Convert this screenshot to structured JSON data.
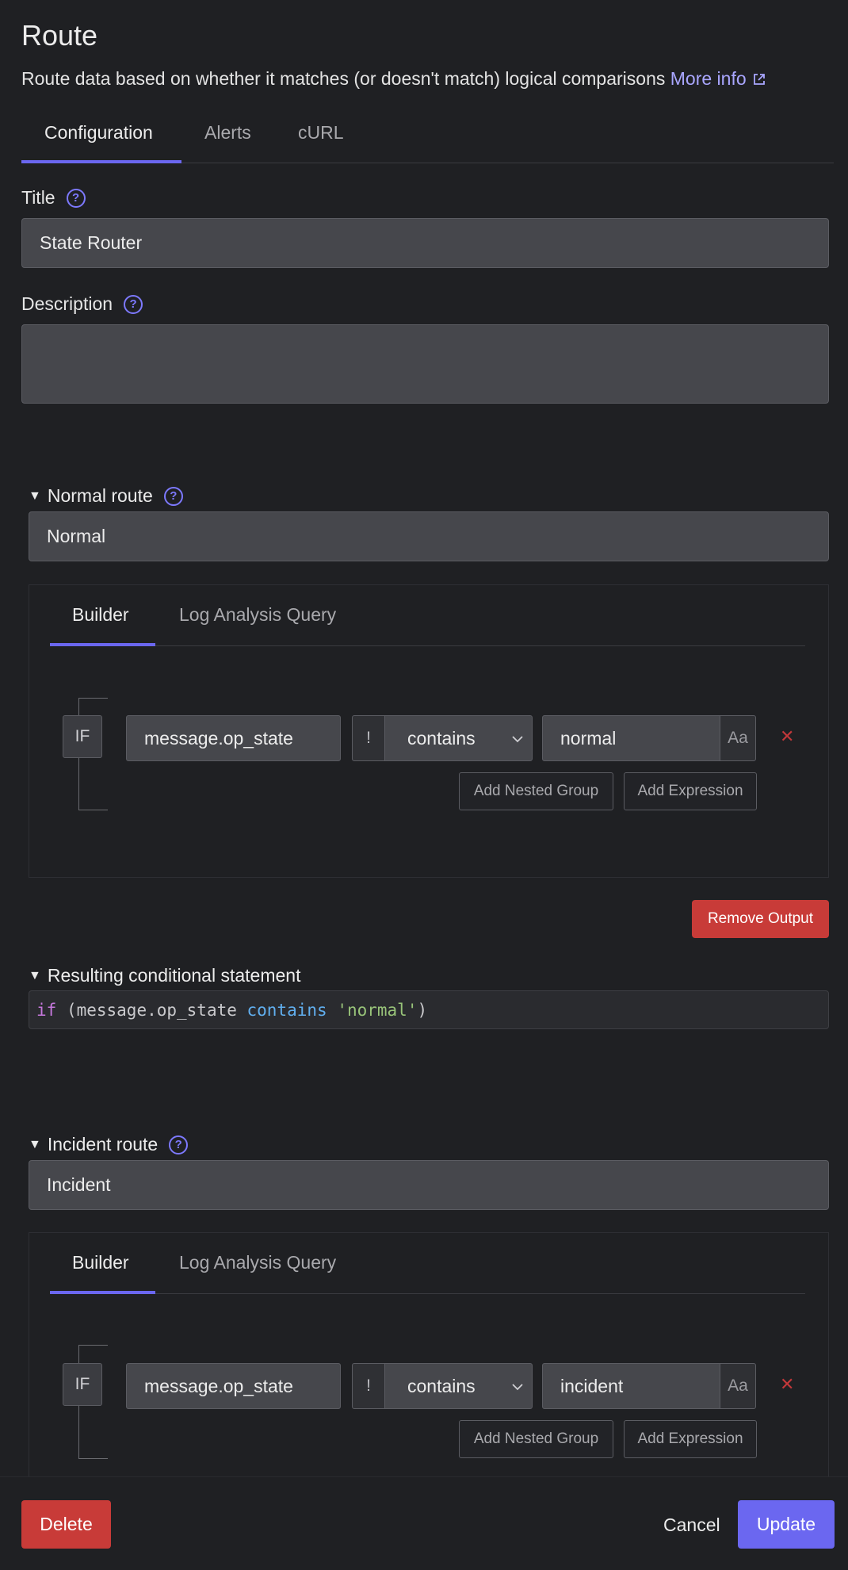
{
  "header": {
    "title": "Route",
    "subtitle": "Route data based on whether it matches (or doesn't match) logical comparisons",
    "more_info": "More info"
  },
  "tabs": [
    {
      "label": "Configuration",
      "active": true
    },
    {
      "label": "Alerts",
      "active": false
    },
    {
      "label": "cURL",
      "active": false
    }
  ],
  "form": {
    "title_label": "Title",
    "title_value": "State Router",
    "description_label": "Description",
    "description_value": ""
  },
  "routes": [
    {
      "label": "Normal route",
      "name": "Normal",
      "subtabs": [
        "Builder",
        "Log Analysis Query"
      ],
      "condition": {
        "if_label": "IF",
        "field": "message.op_state",
        "not_label": "!",
        "operator": "contains",
        "value": "normal",
        "case_label": "Aa"
      },
      "add_nested_group": "Add Nested Group",
      "add_expression": "Add Expression"
    },
    {
      "label": "Incident route",
      "name": "Incident",
      "subtabs": [
        "Builder",
        "Log Analysis Query"
      ],
      "condition": {
        "if_label": "IF",
        "field": "message.op_state",
        "not_label": "!",
        "operator": "contains",
        "value": "incident",
        "case_label": "Aa"
      },
      "add_nested_group": "Add Nested Group",
      "add_expression": "Add Expression"
    }
  ],
  "remove_output": "Remove Output",
  "conditional": {
    "label": "Resulting conditional statement",
    "kw": "if",
    "open": " (message.op_state ",
    "op": "contains",
    "space": " ",
    "str": "'normal'",
    "close": ")"
  },
  "footer": {
    "delete": "Delete",
    "cancel": "Cancel",
    "update": "Update"
  },
  "colors": {
    "accent": "#6b67f0",
    "danger": "#c83b38",
    "background": "#1f2023",
    "link": "#a9a6ff"
  },
  "icons": [
    "external-link-icon",
    "help-icon",
    "triangle-down-icon",
    "chevron-down-icon",
    "close-icon"
  ]
}
